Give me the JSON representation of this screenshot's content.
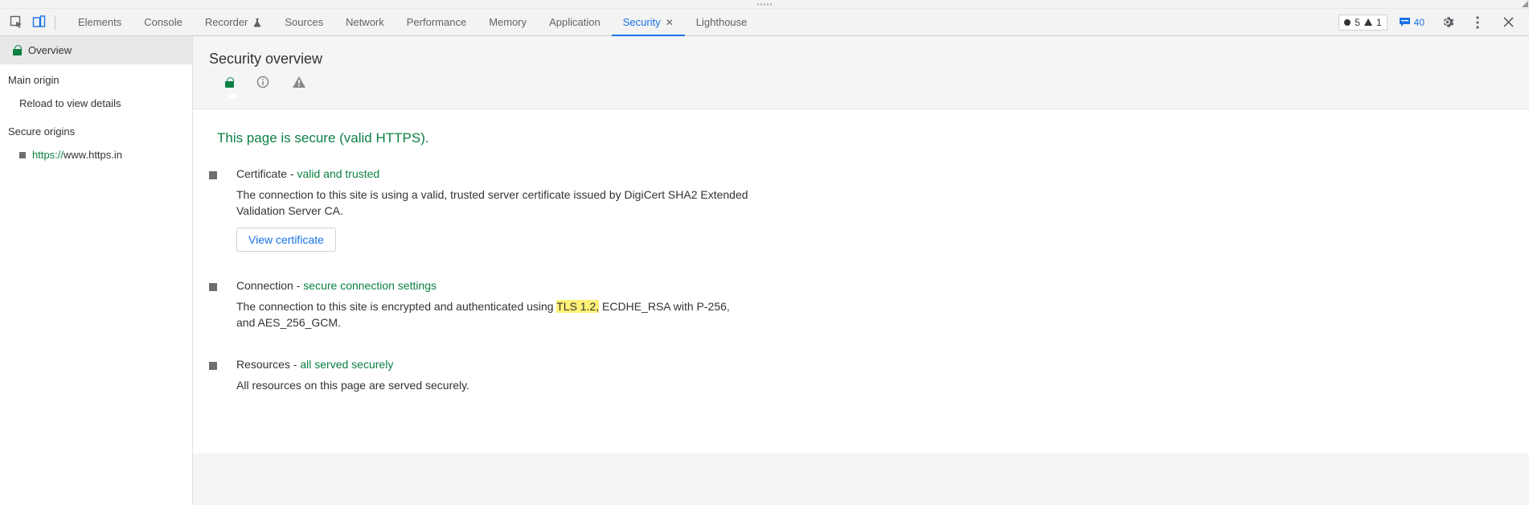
{
  "tabs": {
    "elements": "Elements",
    "console": "Console",
    "recorder": "Recorder",
    "sources": "Sources",
    "network": "Network",
    "performance": "Performance",
    "memory": "Memory",
    "application": "Application",
    "security": "Security",
    "lighthouse": "Lighthouse"
  },
  "status_counts": {
    "errors": "5",
    "warnings": "1",
    "messages": "40"
  },
  "sidebar": {
    "overview": "Overview",
    "main_origin_heading": "Main origin",
    "reload_hint": "Reload to view details",
    "secure_origins_heading": "Secure origins",
    "origin_scheme": "https://",
    "origin_host": "www.https.in"
  },
  "content": {
    "header": "Security overview",
    "secure_title": "This page is secure (valid HTTPS).",
    "certificate": {
      "label": "Certificate",
      "dash": " - ",
      "status": "valid and trusted",
      "desc": "The connection to this site is using a valid, trusted server certificate issued by DigiCert SHA2 Extended Validation Server CA.",
      "button": "View certificate"
    },
    "connection": {
      "label": "Connection",
      "dash": " - ",
      "status": "secure connection settings",
      "desc_pre": "The connection to this site is encrypted and authenticated using ",
      "desc_hl": "TLS 1.2,",
      "desc_post": " ECDHE_RSA with P-256, and AES_256_GCM."
    },
    "resources": {
      "label": "Resources",
      "dash": " - ",
      "status": "all served securely",
      "desc": "All resources on this page are served securely."
    }
  }
}
